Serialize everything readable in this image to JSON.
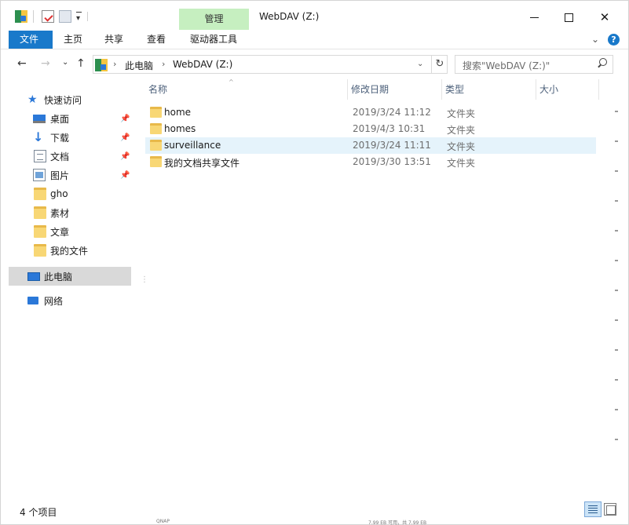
{
  "window": {
    "title": "WebDAV (Z:)",
    "context_tab": "管理"
  },
  "quick_access_toolbar": {
    "icons": [
      "drive-icon",
      "properties-icon",
      "new-folder-icon",
      "customize-dropdown-icon"
    ]
  },
  "ribbon": {
    "tabs": [
      "文件",
      "主页",
      "共享",
      "查看",
      "驱动器工具"
    ],
    "active_tab": "文件",
    "accent_color": "#1979ca",
    "context_color": "#c6efc0"
  },
  "address_bar": {
    "breadcrumbs": [
      "此电脑",
      "WebDAV (Z:)"
    ],
    "refresh_icon": "refresh-icon"
  },
  "search": {
    "placeholder": "搜索\"WebDAV (Z:)\""
  },
  "nav_pane": {
    "items": [
      {
        "label": "快速访问",
        "icon": "star-icon",
        "pinned": false
      },
      {
        "label": "桌面",
        "icon": "desktop-icon",
        "pinned": true
      },
      {
        "label": "下载",
        "icon": "download-icon",
        "pinned": true
      },
      {
        "label": "文档",
        "icon": "document-icon",
        "pinned": true
      },
      {
        "label": "图片",
        "icon": "pictures-icon",
        "pinned": true
      },
      {
        "label": "gho",
        "icon": "folder-icon",
        "pinned": false
      },
      {
        "label": "素材",
        "icon": "folder-icon",
        "pinned": false
      },
      {
        "label": "文章",
        "icon": "folder-icon",
        "pinned": false
      },
      {
        "label": "我的文件",
        "icon": "folder-icon",
        "pinned": false
      },
      {
        "label": "此电脑",
        "icon": "computer-icon",
        "pinned": false
      },
      {
        "label": "网络",
        "icon": "network-icon",
        "pinned": false
      }
    ],
    "selected": "此电脑"
  },
  "file_list": {
    "columns": [
      "名称",
      "修改日期",
      "类型",
      "大小"
    ],
    "rows": [
      {
        "name": "home",
        "date": "2019/3/24 11:12",
        "type": "文件夹",
        "size": ""
      },
      {
        "name": "homes",
        "date": "2019/4/3 10:31",
        "type": "文件夹",
        "size": ""
      },
      {
        "name": "surveillance",
        "date": "2019/3/24 11:11",
        "type": "文件夹",
        "size": ""
      },
      {
        "name": "我的文档共享文件",
        "date": "2019/3/30 13:51",
        "type": "文件夹",
        "size": ""
      }
    ],
    "selected_row": 2
  },
  "status_bar": {
    "item_count": "4 个项目"
  },
  "taskbar_ghost": {
    "text_1": "QNAP",
    "text_2": "7.99 EB 可用，共 7.99 EB"
  }
}
